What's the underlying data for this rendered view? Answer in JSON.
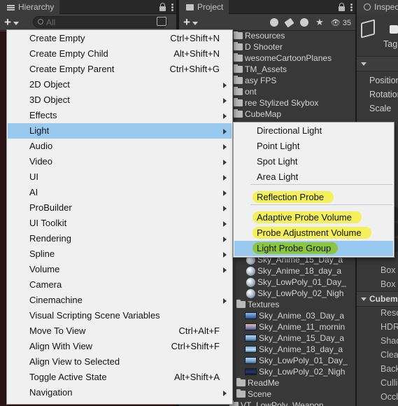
{
  "hierarchy": {
    "tab_title": "Hierarchy",
    "add_label": "+",
    "search_placeholder": "All"
  },
  "project": {
    "tab_title": "Project",
    "add_label": "+",
    "visible_count": "35",
    "items": [
      {
        "label": "Resources",
        "icon": "folder-icon"
      },
      {
        "label": "D Shooter",
        "icon": "folder-icon"
      },
      {
        "label": "wesomeCartoonPlanes",
        "icon": "folder-icon"
      },
      {
        "label": "TM_Assets",
        "icon": "folder-icon"
      },
      {
        "label": "asy FPS",
        "icon": "folder-icon"
      },
      {
        "label": "ont",
        "icon": "folder-icon"
      },
      {
        "label": "ree Stylized Skybox",
        "icon": "folder-icon"
      },
      {
        "label": "CubeMap",
        "icon": "folder-icon"
      },
      {
        "label": "Sky_Anime_15_Day_a",
        "icon": "material-sphere-icon"
      },
      {
        "label": "Sky_Anime_18_day_a",
        "icon": "material-sphere-icon"
      },
      {
        "label": "Sky_LowPoly_01_Day_",
        "icon": "material-sphere-icon"
      },
      {
        "label": "Sky_LowPoly_02_Nigh",
        "icon": "material-sphere-icon"
      },
      {
        "label": "Textures",
        "icon": "folder-icon"
      },
      {
        "label": "Sky_Anime_03_Day_a",
        "icon": "texture-icon"
      },
      {
        "label": "Sky_Anime_11_mornin",
        "icon": "texture-icon"
      },
      {
        "label": "Sky_Anime_15_Day_a",
        "icon": "texture-icon"
      },
      {
        "label": "Sky_Anime_18_day_a",
        "icon": "texture-icon"
      },
      {
        "label": "Sky_LowPoly_01_Day_",
        "icon": "texture-icon"
      },
      {
        "label": "Sky_LowPoly_02_Nigh",
        "icon": "texture-icon"
      },
      {
        "label": "ReadMe",
        "icon": "folder-icon"
      },
      {
        "label": "Scene",
        "icon": "folder-icon"
      },
      {
        "label": "VT_LowPoly_Weapon",
        "icon": "folder-icon"
      }
    ]
  },
  "inspector": {
    "tab_title": "Inspec",
    "tag_label": "Tag",
    "transform_rows": [
      "Position",
      "Rotation",
      "Scale"
    ],
    "lower_rows": [
      "Box C",
      "Box C"
    ],
    "section_title": "Cubem",
    "section_rows": [
      "Resol",
      "HDR",
      "Shad",
      "Clear",
      "Back",
      "Culli",
      "Occl"
    ]
  },
  "context_menu": {
    "items": [
      {
        "label": "Create Empty",
        "shortcut": "Ctrl+Shift+N",
        "submenu": false
      },
      {
        "label": "Create Empty Child",
        "shortcut": "Alt+Shift+N",
        "submenu": false
      },
      {
        "label": "Create Empty Parent",
        "shortcut": "Ctrl+Shift+G",
        "submenu": false
      },
      {
        "label": "2D Object",
        "shortcut": "",
        "submenu": true
      },
      {
        "label": "3D Object",
        "shortcut": "",
        "submenu": true
      },
      {
        "label": "Effects",
        "shortcut": "",
        "submenu": true
      },
      {
        "label": "Light",
        "shortcut": "",
        "submenu": true,
        "active": true
      },
      {
        "label": "Audio",
        "shortcut": "",
        "submenu": true
      },
      {
        "label": "Video",
        "shortcut": "",
        "submenu": true
      },
      {
        "label": "UI",
        "shortcut": "",
        "submenu": true
      },
      {
        "label": "AI",
        "shortcut": "",
        "submenu": true
      },
      {
        "label": "ProBuilder",
        "shortcut": "",
        "submenu": true
      },
      {
        "label": "UI Toolkit",
        "shortcut": "",
        "submenu": true
      },
      {
        "label": "Rendering",
        "shortcut": "",
        "submenu": true
      },
      {
        "label": "Spline",
        "shortcut": "",
        "submenu": true
      },
      {
        "label": "Volume",
        "shortcut": "",
        "submenu": true
      },
      {
        "label": "Camera",
        "shortcut": "",
        "submenu": false
      },
      {
        "label": "Cinemachine",
        "shortcut": "",
        "submenu": true
      },
      {
        "label": "Visual Scripting Scene Variables",
        "shortcut": "",
        "submenu": false
      },
      {
        "label": "Move To View",
        "shortcut": "Ctrl+Alt+F",
        "submenu": false
      },
      {
        "label": "Align With View",
        "shortcut": "Ctrl+Shift+F",
        "submenu": false
      },
      {
        "label": "Align View to Selected",
        "shortcut": "",
        "submenu": false
      },
      {
        "label": "Toggle Active State",
        "shortcut": "Alt+Shift+A",
        "submenu": false
      },
      {
        "label": "Navigation",
        "shortcut": "",
        "submenu": true
      }
    ]
  },
  "light_submenu": {
    "items": [
      {
        "label": "Directional Light"
      },
      {
        "label": "Point Light"
      },
      {
        "label": "Spot Light"
      },
      {
        "label": "Area Light"
      },
      {
        "label": "Reflection Probe",
        "highlight": "yellow"
      },
      {
        "label": "Adaptive Probe Volume",
        "highlight": "yellow"
      },
      {
        "label": "Probe Adjustment Volume",
        "highlight": "yellow"
      },
      {
        "label": "Light Probe Group",
        "highlight": "green",
        "active": true
      }
    ]
  },
  "colors": {
    "menu_bg": "#f0f0f0",
    "menu_active": "#99c9ef",
    "highlight_yellow": "#f3f05a",
    "highlight_green": "#8cc63f",
    "panel_bg": "#383838"
  }
}
